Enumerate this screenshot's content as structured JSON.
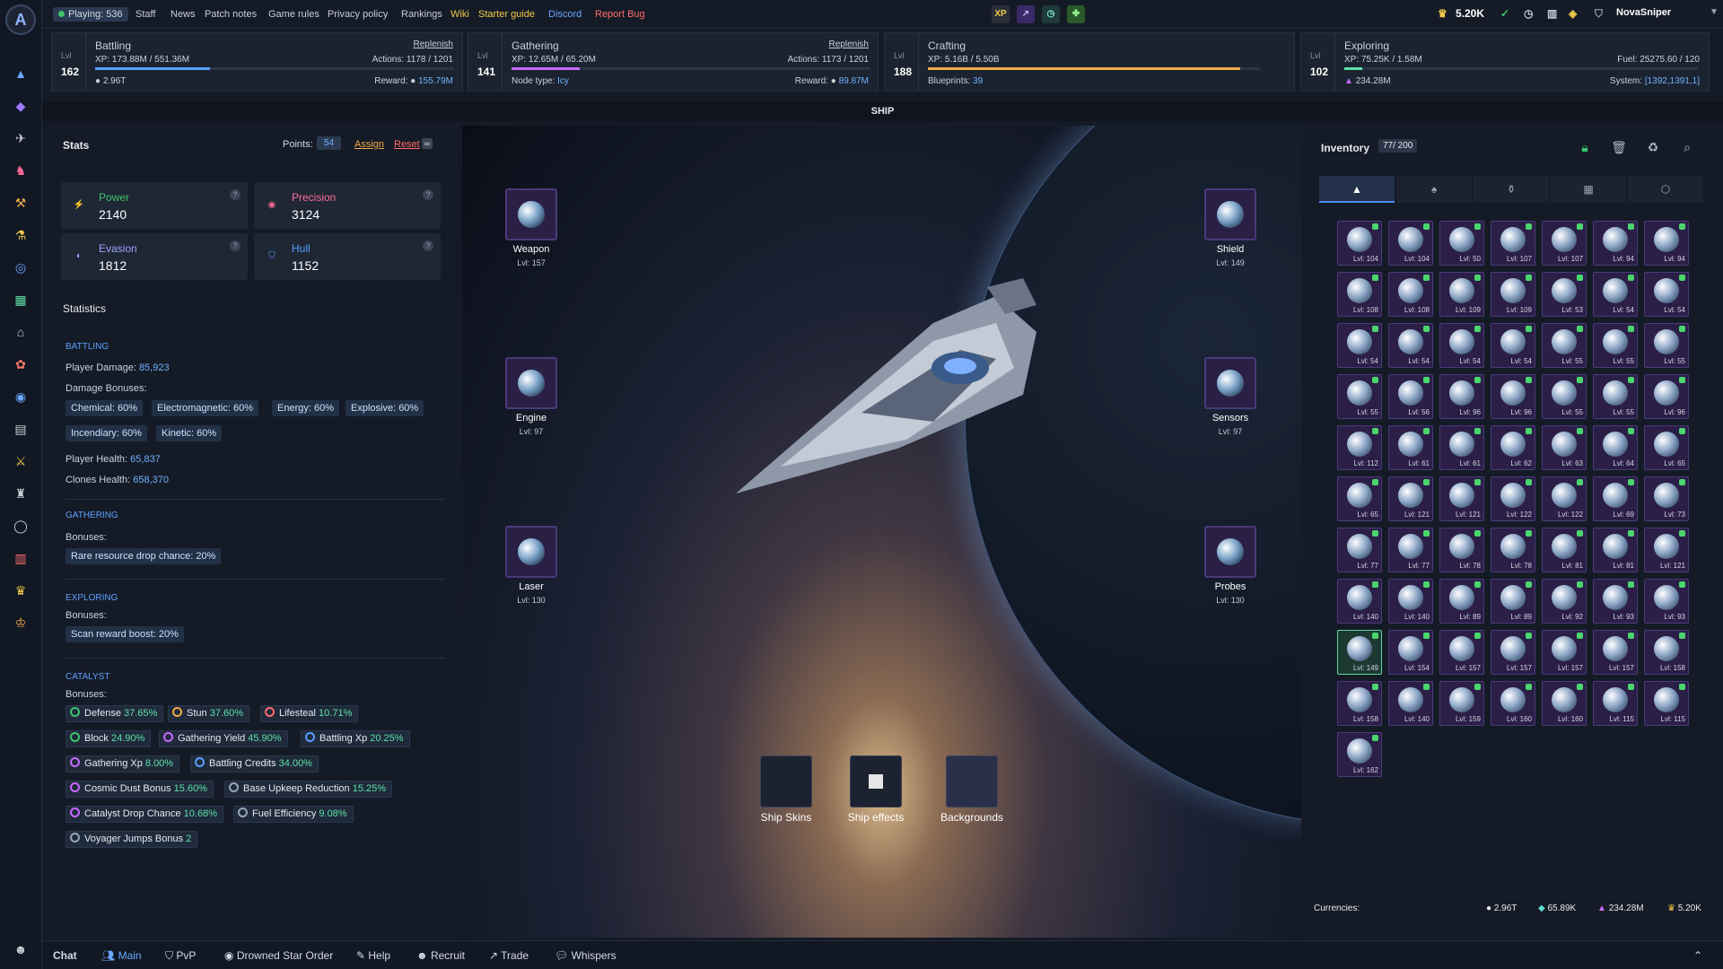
{
  "app": {
    "logo": "A"
  },
  "topbar": {
    "playing": "Playing: 536",
    "links": [
      "Staff",
      "News",
      "Patch notes",
      "Game rules",
      "Privacy policy",
      "Rankings",
      "Wiki",
      "Starter guide",
      "Discord",
      "Report Bug"
    ],
    "xp_badge": "XP",
    "gold": "5.20K",
    "username": "NovaSniper"
  },
  "skills": [
    {
      "lvl_label": "Lvl",
      "level": "162",
      "name": "Battling",
      "link": "Replenish",
      "xp": "XP: 173.88M / 551.36M",
      "actions": "Actions: 1178 / 1201",
      "left_bottom": "2.96T",
      "reward": "Reward:",
      "reward_val": "155.79M",
      "progress": 0.32
    },
    {
      "lvl_label": "Lvl",
      "level": "141",
      "name": "Gathering",
      "link": "Replenish",
      "xp": "XP: 12.65M / 65.20M",
      "actions": "Actions: 1173 / 1201",
      "left_bottom": "Node type:",
      "left_val": "Icy",
      "reward": "Reward:",
      "reward_val": "89.87M",
      "progress": 0.19
    },
    {
      "lvl_label": "Lvl",
      "level": "188",
      "name": "Crafting",
      "xp": "XP: 5.16B / 5.50B",
      "left_bottom": "Blueprints:",
      "left_val": "39",
      "progress": 0.94
    },
    {
      "lvl_label": "Lvl",
      "level": "102",
      "name": "Exploring",
      "xp": "XP: 75.25K / 1.58M",
      "fuel": "Fuel: 25275.60 / 120",
      "left_bottom": "234.28M",
      "system": "System:",
      "system_val": "[1392,1391,1]",
      "progress": 0.05
    }
  ],
  "page": {
    "title": "SHIP"
  },
  "stats": {
    "title": "Stats",
    "points_label": "Points:",
    "points": "54",
    "assign": "Assign",
    "reset": "Reset",
    "cards": [
      {
        "name": "Power",
        "value": "2140",
        "color": "#3ec46d"
      },
      {
        "name": "Precision",
        "value": "3124",
        "color": "#ff6b9a"
      },
      {
        "name": "Evasion",
        "value": "1812",
        "color": "#9aa4ff"
      },
      {
        "name": "Hull",
        "value": "1152",
        "color": "#5aa0ff"
      }
    ],
    "statistics_title": "Statistics",
    "battling": {
      "title": "BATTLING",
      "player_damage_label": "Player Damage:",
      "player_damage": "85,923",
      "damage_bonuses": "Damage Bonuses:",
      "chips": [
        "Chemical: 60%",
        "Electromagnetic: 60%",
        "Energy: 60%",
        "Explosive: 60%",
        "Incendiary: 60%",
        "Kinetic: 60%"
      ],
      "health_label": "Player Health:",
      "health": "65,837",
      "clones_label": "Clones Health:",
      "clones": "658,370"
    },
    "gathering": {
      "title": "GATHERING",
      "bonuses": "Bonuses:",
      "chip": "Rare resource drop chance: 20%"
    },
    "exploring": {
      "title": "EXPLORING",
      "bonuses": "Bonuses:",
      "chip": "Scan reward boost: 20%"
    },
    "catalyst": {
      "title": "CATALYST",
      "bonuses": "Bonuses:",
      "chips": [
        {
          "name": "Defense",
          "pct": "37.65%"
        },
        {
          "name": "Stun",
          "pct": "37.60%"
        },
        {
          "name": "Lifesteal",
          "pct": "10.71%"
        },
        {
          "name": "Block",
          "pct": "24.90%"
        },
        {
          "name": "Gathering Yield",
          "pct": "45.90%"
        },
        {
          "name": "Battling Xp",
          "pct": "20.25%"
        },
        {
          "name": "Gathering Xp",
          "pct": "8.00%"
        },
        {
          "name": "Battling Credits",
          "pct": "34.00%"
        },
        {
          "name": "Cosmic Dust Bonus",
          "pct": "15.60%"
        },
        {
          "name": "Base Upkeep Reduction",
          "pct": "15.25%"
        },
        {
          "name": "Catalyst Drop Chance",
          "pct": "10.68%"
        },
        {
          "name": "Fuel Efficiency",
          "pct": "9.08%"
        },
        {
          "name": "Voyager Jumps Bonus",
          "pct": "2"
        }
      ]
    }
  },
  "slots": [
    {
      "name": "Weapon",
      "lvl": "Lvl: 157"
    },
    {
      "name": "Engine",
      "lvl": "Lvl: 97"
    },
    {
      "name": "Laser",
      "lvl": "Lvl: 130"
    },
    {
      "name": "Shield",
      "lvl": "Lvl: 149"
    },
    {
      "name": "Sensors",
      "lvl": "Lvl: 97"
    },
    {
      "name": "Probes",
      "lvl": "Lvl: 130"
    }
  ],
  "customize": [
    {
      "label": "Ship Skins"
    },
    {
      "label": "Ship effects"
    },
    {
      "label": "Backgrounds"
    }
  ],
  "inventory": {
    "title": "Inventory",
    "count": "77/ 200",
    "items": [
      "Lvl: 104",
      "Lvl: 104",
      "Lvl: 50",
      "Lvl: 107",
      "Lvl: 107",
      "Lvl: 94",
      "Lvl: 94",
      "Lvl: 108",
      "Lvl: 108",
      "Lvl: 109",
      "Lvl: 109",
      "Lvl: 53",
      "Lvl: 54",
      "Lvl: 54",
      "Lvl: 54",
      "Lvl: 54",
      "Lvl: 54",
      "Lvl: 54",
      "Lvl: 55",
      "Lvl: 55",
      "Lvl: 55",
      "Lvl: 55",
      "Lvl: 56",
      "Lvl: 96",
      "Lvl: 96",
      "Lvl: 55",
      "Lvl: 55",
      "Lvl: 96",
      "Lvl: 112",
      "Lvl: 61",
      "Lvl: 61",
      "Lvl: 62",
      "Lvl: 63",
      "Lvl: 64",
      "Lvl: 65",
      "Lvl: 65",
      "Lvl: 121",
      "Lvl: 121",
      "Lvl: 122",
      "Lvl: 122",
      "Lvl: 69",
      "Lvl: 73",
      "Lvl: 77",
      "Lvl: 77",
      "Lvl: 78",
      "Lvl: 78",
      "Lvl: 81",
      "Lvl: 81",
      "Lvl: 121",
      "Lvl: 140",
      "Lvl: 140",
      "Lvl: 89",
      "Lvl: 89",
      "Lvl: 92",
      "Lvl: 93",
      "Lvl: 93",
      "Lvl: 149",
      "Lvl: 154",
      "Lvl: 157",
      "Lvl: 157",
      "Lvl: 157",
      "Lvl: 157",
      "Lvl: 158",
      "Lvl: 158",
      "Lvl: 140",
      "Lvl: 159",
      "Lvl: 160",
      "Lvl: 160",
      "Lvl: 115",
      "Lvl: 115",
      "Lvl: 162"
    ]
  },
  "currencies": {
    "label": "Currencies:",
    "c1": "2.96T",
    "c2": "65.89K",
    "c3": "234.28M",
    "c4": "5.20K"
  },
  "chat": {
    "title": "Chat",
    "tabs": [
      "Main",
      "PvP",
      "Drowned Star Order",
      "Help",
      "Recruit",
      "Trade",
      "Whispers"
    ]
  }
}
